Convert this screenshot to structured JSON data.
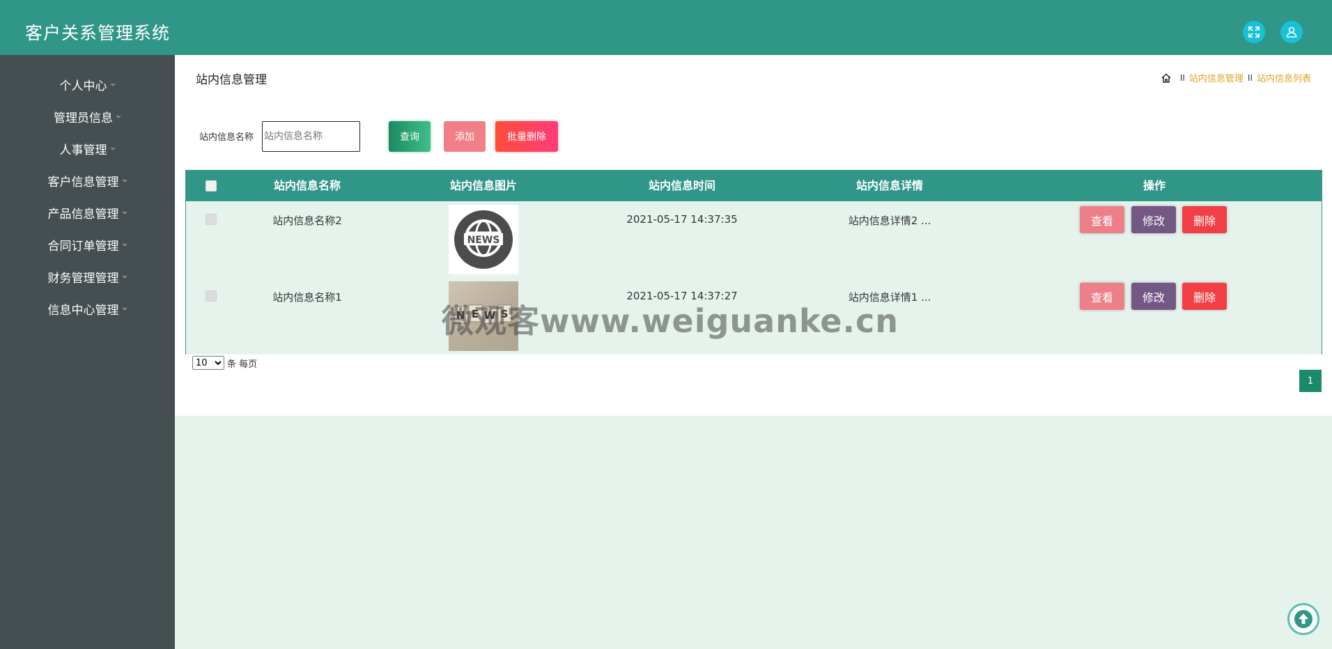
{
  "header": {
    "app_title": "客户关系管理系统",
    "expand_icon": "fullscreen-icon",
    "user_icon": "user-icon",
    "color": "#2f9688"
  },
  "sidebar": {
    "items": [
      {
        "label": "个人中心"
      },
      {
        "label": "管理员信息"
      },
      {
        "label": "人事管理"
      },
      {
        "label": "客户信息管理"
      },
      {
        "label": "产品信息管理"
      },
      {
        "label": "合同订单管理"
      },
      {
        "label": "财务管理管理"
      },
      {
        "label": "信息中心管理"
      }
    ]
  },
  "main": {
    "page_title": "站内信息管理",
    "breadcrumb": {
      "separator": "II",
      "items": [
        "站内信息管理",
        "站内信息列表"
      ]
    },
    "search": {
      "label": "站内信息名称",
      "placeholder": "站内信息名称",
      "value": "",
      "query_label": "查询",
      "add_label": "添加",
      "batch_delete_label": "批量删除"
    },
    "table": {
      "columns": [
        "站内信息名称",
        "站内信息图片",
        "站内信息时间",
        "站内信息详情",
        "操作"
      ],
      "rows": [
        {
          "name": "站内信息名称2",
          "image": "news-globe",
          "time": "2021-05-17 14:37:35",
          "detail": "站内信息详情2 ..."
        },
        {
          "name": "站内信息名称1",
          "image": "news-blocks",
          "time": "2021-05-17 14:37:27",
          "detail": "站内信息详情1 ..."
        }
      ],
      "actions": {
        "view": "查看",
        "edit": "修改",
        "delete": "删除"
      }
    },
    "pagination": {
      "page_size": "10",
      "page_size_text": "条 每页",
      "current_page": "1"
    }
  },
  "watermark": "微观客www.weiguanke.cn"
}
